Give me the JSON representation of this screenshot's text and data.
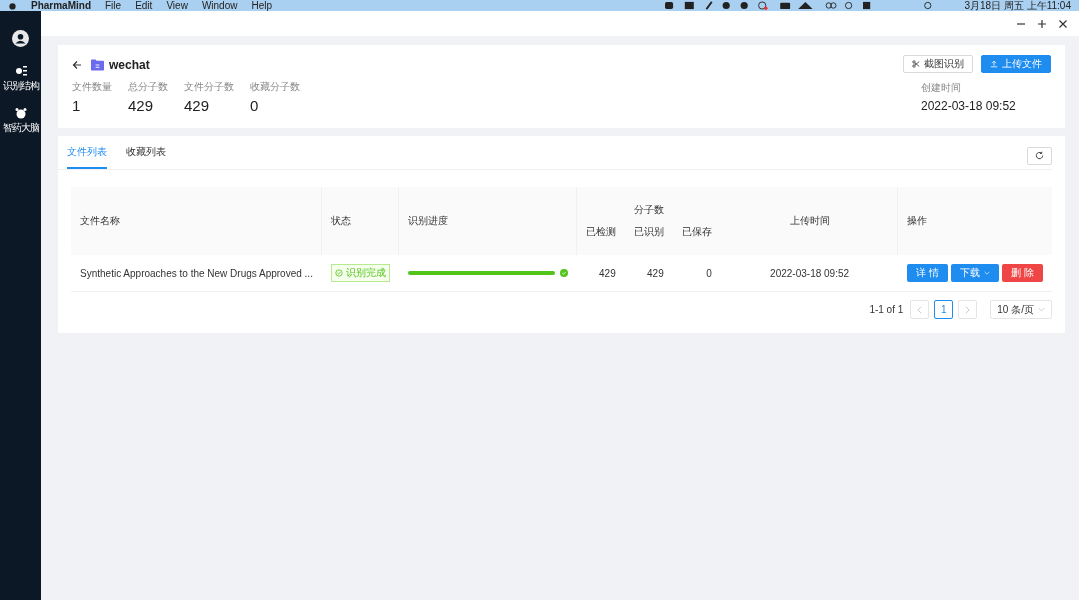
{
  "menu_bar": {
    "app": "PharmaMind",
    "menus": [
      "File",
      "Edit",
      "View",
      "Window",
      "Help"
    ],
    "clock": "3月18日 周五 上午11:04"
  },
  "sidebar": {
    "items": [
      {
        "label": "识别结构",
        "kind": "structure"
      },
      {
        "label": "智药大脑",
        "kind": "brain"
      }
    ]
  },
  "header": {
    "title": "wechat",
    "stats": [
      {
        "label": "文件数量",
        "value": "1"
      },
      {
        "label": "总分子数",
        "value": "429"
      },
      {
        "label": "文件分子数",
        "value": "429"
      },
      {
        "label": "收藏分子数",
        "value": "0"
      }
    ],
    "buttons": [
      {
        "label": "截图识别",
        "kind": "default"
      },
      {
        "label": "上传文件",
        "kind": "primary"
      }
    ],
    "created_label": "创建时间",
    "created_value": "2022-03-18 09:52"
  },
  "tabs": [
    {
      "label": "文件列表",
      "selected": true
    },
    {
      "label": "收藏列表",
      "selected": false
    }
  ],
  "table": {
    "columns": {
      "name": "文件名称",
      "status": "状态",
      "progress": "识别进度",
      "molecules": "分子数",
      "detected": "已检测",
      "recognized": "已识别",
      "saved": "已保存",
      "uploaded": "上传时间",
      "actions": "操作"
    },
    "rows": [
      {
        "name": "Synthetic Approaches to the New Drugs Approved ...",
        "status": "识别完成",
        "level": 1,
        "detected": "429",
        "recognized": "429",
        "saved": "0",
        "uploaded": "2022-03-18 09:52",
        "actions": [
          {
            "label": "详 情",
            "kind": "primary"
          },
          {
            "label": "下载",
            "kind": "dropdown"
          },
          {
            "label": "删 除",
            "kind": "danger"
          }
        ]
      }
    ]
  },
  "pagination": {
    "summary": "1-1 of 1",
    "pages": [
      {
        "label": "1",
        "selected": true
      }
    ],
    "page_size": "10 条/页"
  }
}
